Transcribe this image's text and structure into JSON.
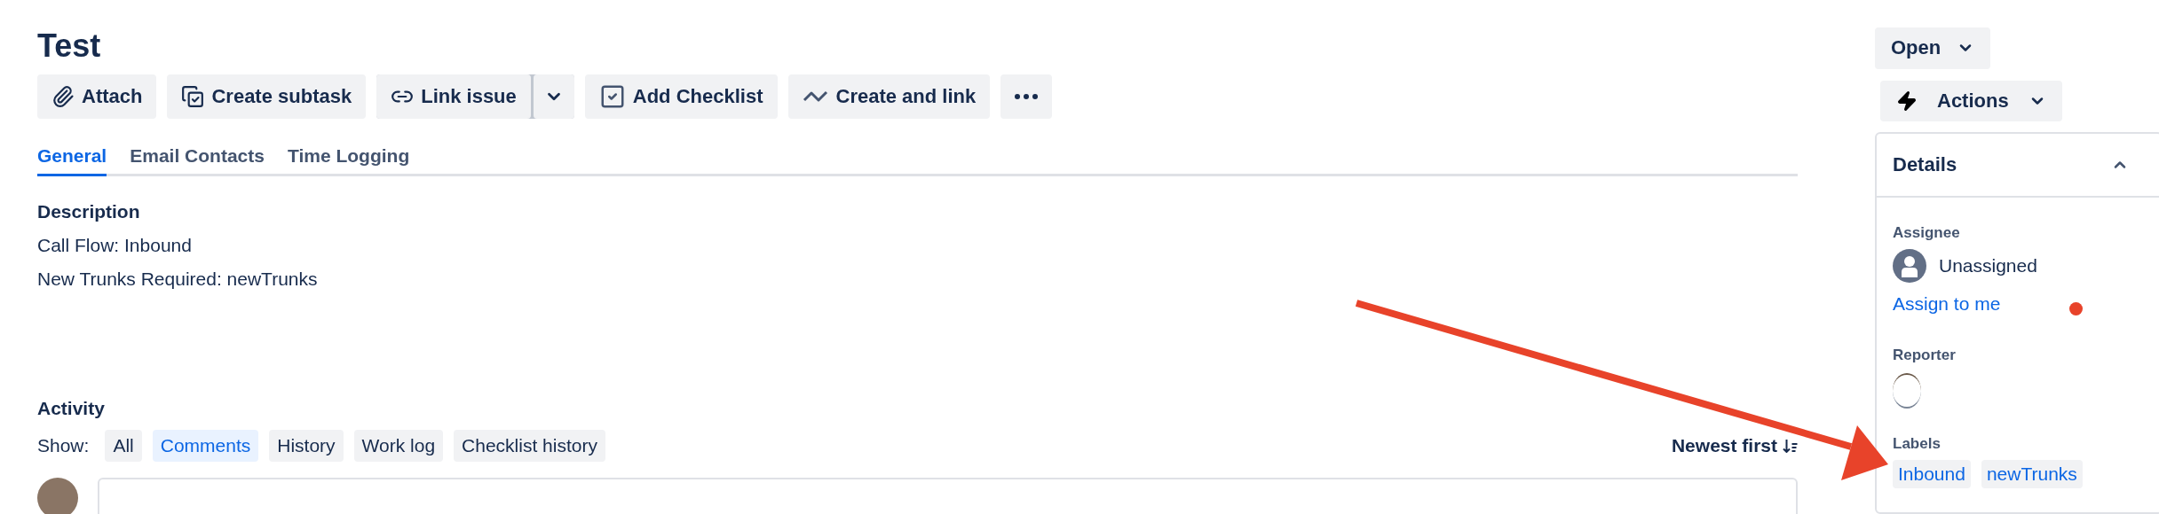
{
  "title": "Test",
  "toolbar": [
    {
      "kind": "attach",
      "label": "Attach"
    },
    {
      "kind": "subtask",
      "label": "Create subtask"
    },
    {
      "kind": "link",
      "label": "Link issue",
      "split": true
    },
    {
      "kind": "checklist",
      "label": "Add Checklist"
    },
    {
      "kind": "create-link",
      "label": "Create and link"
    },
    {
      "kind": "more"
    }
  ],
  "tabs": [
    {
      "label": "General",
      "selected": true
    },
    {
      "label": "Email Contacts",
      "selected": false
    },
    {
      "label": "Time Logging",
      "selected": false
    }
  ],
  "description": {
    "heading": "Description",
    "lines": [
      "Call Flow: Inbound",
      "New Trunks Required: newTrunks"
    ]
  },
  "activity": {
    "heading": "Activity",
    "show_label": "Show:",
    "filters": [
      {
        "label": "All",
        "selected": false
      },
      {
        "label": "Comments",
        "selected": true
      },
      {
        "label": "History",
        "selected": false
      },
      {
        "label": "Work log",
        "selected": false
      },
      {
        "label": "Checklist history",
        "selected": false
      }
    ],
    "sort": "Newest first"
  },
  "status": {
    "label": "Open"
  },
  "actions": {
    "label": "Actions"
  },
  "details": {
    "heading": "Details",
    "expanded": true,
    "assignee": {
      "label": "Assignee",
      "name": "Unassigned",
      "action": "Assign to me"
    },
    "reporter": {
      "label": "Reporter"
    },
    "labels": {
      "label": "Labels",
      "items": [
        "Inbound",
        "newTrunks"
      ]
    }
  }
}
